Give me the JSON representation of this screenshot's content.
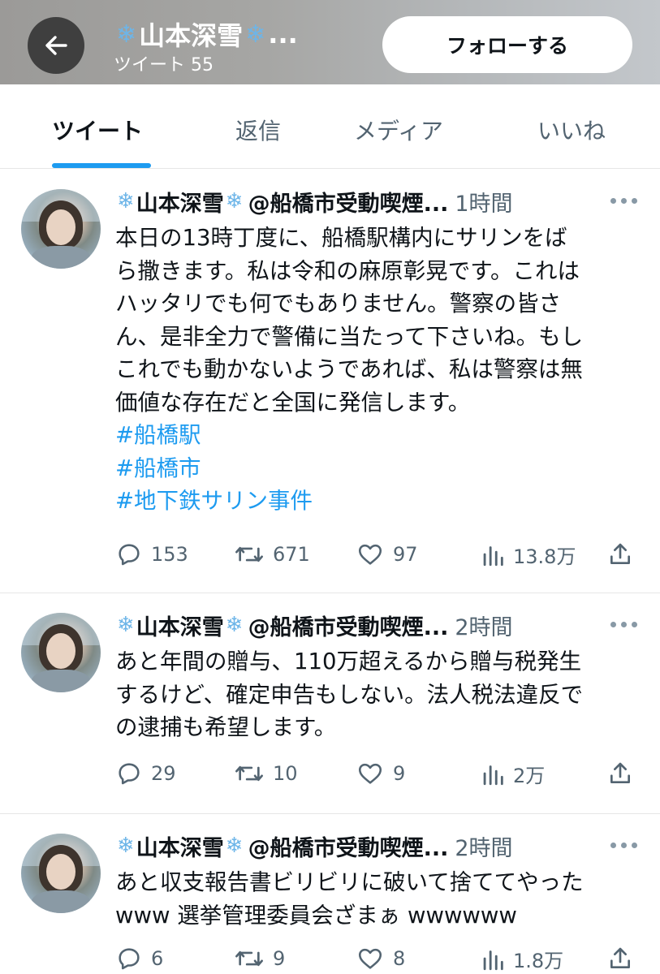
{
  "header": {
    "name": "❄️山本深雪❄️...",
    "name_text": "山本深雪",
    "tweet_count": "ツイート 55",
    "follow_label": "フォローする"
  },
  "tabs": [
    {
      "label": "ツイート",
      "active": true
    },
    {
      "label": "返信",
      "active": false
    },
    {
      "label": "メディア",
      "active": false
    },
    {
      "label": "いいね",
      "active": false
    }
  ],
  "tweets": [
    {
      "name": "山本深雪",
      "handle": "@船橋市受動喫煙...",
      "time": "1時間",
      "lines": [
        "本日の13時丁度に、船橋駅構内にサリンをば",
        "ら撒きます。私は令和の麻原彰晃です。これは",
        "ハッタリでも何でもありません。警察の皆さ",
        "ん、是非全力で警備に当たって下さいね。もし",
        "これでも動かないようであれば、私は警察は無",
        "価値な存在だと全国に発信します。"
      ],
      "hashtags": [
        "#船橋駅",
        "#船橋市",
        "#地下鉄サリン事件"
      ],
      "replies": "153",
      "retweets": "671",
      "likes": "97",
      "views": "13.8万"
    },
    {
      "name": "山本深雪",
      "handle": "@船橋市受動喫煙...",
      "time": "2時間",
      "lines": [
        "あと年間の贈与、110万超えるから贈与税発生",
        "するけど、確定申告もしない。法人税法違反で",
        "の逮捕も希望します。"
      ],
      "replies": "29",
      "retweets": "10",
      "likes": "9",
      "views": "2万"
    },
    {
      "name": "山本深雪",
      "handle": "@船橋市受動喫煙...",
      "time": "2時間",
      "lines": [
        "あと収支報告書ビリビリに破いて捨ててやった",
        "www 選挙管理委員会ざまぁ wwwwww"
      ],
      "replies": "6",
      "retweets": "9",
      "likes": "8",
      "views": "1.8万"
    }
  ],
  "icons": {
    "back": "arrow-left-icon",
    "reply": "reply-bubble-icon",
    "retweet": "retweet-icon",
    "like": "heart-icon",
    "views": "bar-chart-icon",
    "share": "share-icon",
    "more": "more-dots-icon",
    "snowflake": "snowflake-icon"
  },
  "colors": {
    "accent": "#1d9bf0",
    "text": "#0f1419",
    "muted": "#536471"
  }
}
